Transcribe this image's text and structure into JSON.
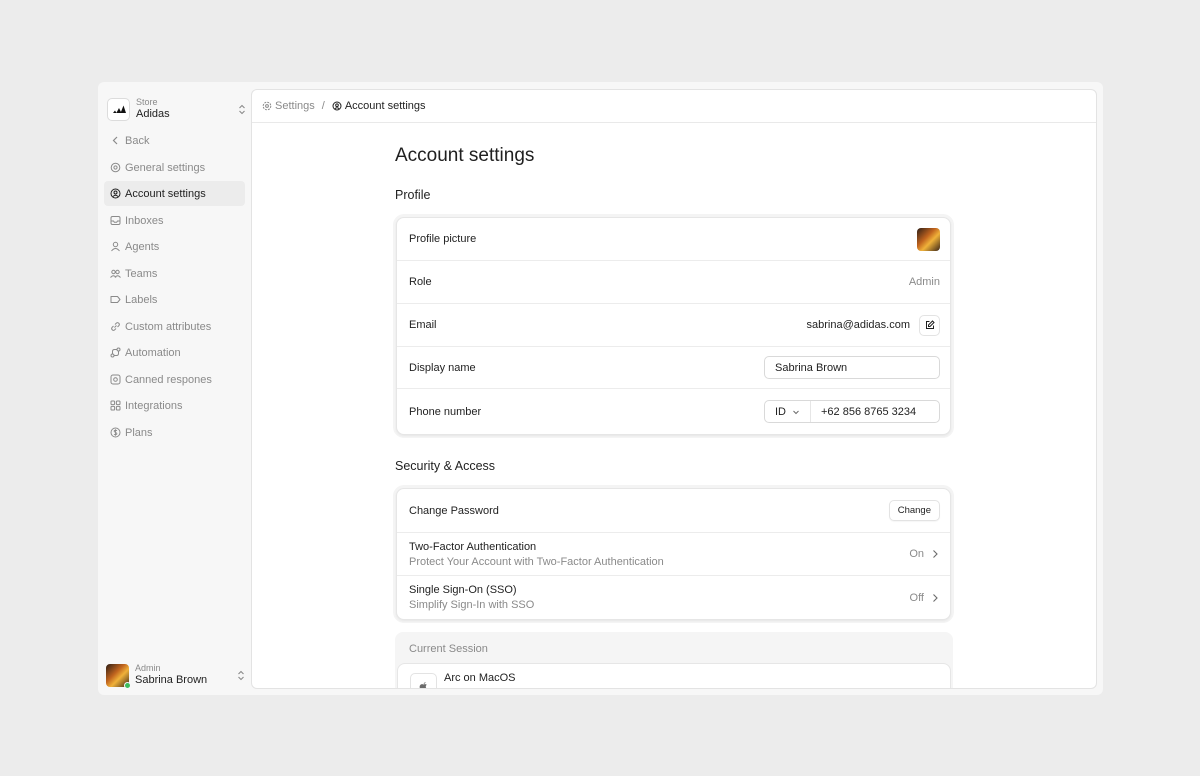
{
  "store": {
    "label": "Store",
    "name": "Adidas"
  },
  "sidebar": {
    "back_label": "Back",
    "items": [
      {
        "label": "General settings",
        "icon": "gear-icon",
        "active": false
      },
      {
        "label": "Account settings",
        "icon": "account-icon",
        "active": true
      },
      {
        "label": "Inboxes",
        "icon": "inbox-icon",
        "active": false
      },
      {
        "label": "Agents",
        "icon": "user-icon",
        "active": false
      },
      {
        "label": "Teams",
        "icon": "team-icon",
        "active": false
      },
      {
        "label": "Labels",
        "icon": "label-icon",
        "active": false
      },
      {
        "label": "Custom attributes",
        "icon": "link-icon",
        "active": false
      },
      {
        "label": "Automation",
        "icon": "automation-icon",
        "active": false
      },
      {
        "label": "Canned respones",
        "icon": "canned-icon",
        "active": false
      },
      {
        "label": "Integrations",
        "icon": "grid-icon",
        "active": false
      },
      {
        "label": "Plans",
        "icon": "dollar-icon",
        "active": false
      }
    ]
  },
  "user": {
    "role": "Admin",
    "name": "Sabrina Brown"
  },
  "breadcrumb": {
    "parent": "Settings",
    "separator": "/",
    "current": "Account settings"
  },
  "page": {
    "title": "Account settings"
  },
  "profile": {
    "title": "Profile",
    "picture_label": "Profile picture",
    "role_label": "Role",
    "role_value": "Admin",
    "email_label": "Email",
    "email_value": "sabrina@adidas.com",
    "display_name_label": "Display name",
    "display_name_value": "Sabrina Brown",
    "phone_label": "Phone number",
    "phone_country": "ID",
    "phone_value": "+62 856 8765 3234"
  },
  "security": {
    "title": "Security & Access",
    "password_label": "Change Password",
    "password_button": "Change",
    "twofa_label": "Two-Factor Authentication",
    "twofa_sub": "Protect Your Account with Two-Factor Authentication",
    "twofa_value": "On",
    "sso_label": "Single Sign-On (SSO)",
    "sso_sub": "Simplify Sign-In with SSO",
    "sso_value": "Off"
  },
  "session": {
    "title": "Current Session",
    "device": "Arc on MacOS"
  }
}
